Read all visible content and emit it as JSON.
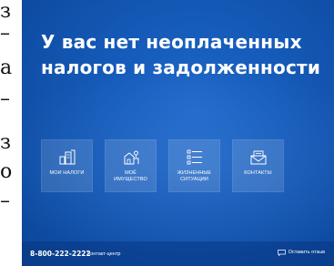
{
  "left_strip": {
    "glyphs": [
      "з",
      "–",
      "а",
      "–",
      "з",
      "о",
      "–"
    ]
  },
  "headline": {
    "line1": "У вас нет неоплаченных",
    "line2": "налогов и задолженности"
  },
  "tiles": [
    {
      "label": "МОИ НАЛОГИ",
      "icon": "tax-document-icon"
    },
    {
      "label": "МОЁ\nИМУЩЕСТВО",
      "icon": "property-icon"
    },
    {
      "label": "ЖИЗНЕННЫЕ\nСИТУАЦИИ",
      "icon": "checklist-icon"
    },
    {
      "label": "КОНТАКТЫ",
      "icon": "envelope-icon"
    }
  ],
  "footer": {
    "phone": "8-800-222-2222",
    "phone_label": "Контакт-центр",
    "feedback_label": "Оставить отзыв",
    "feedback_icon": "chat-icon"
  },
  "colors": {
    "background": "#155ab8",
    "text": "#ffffff"
  }
}
